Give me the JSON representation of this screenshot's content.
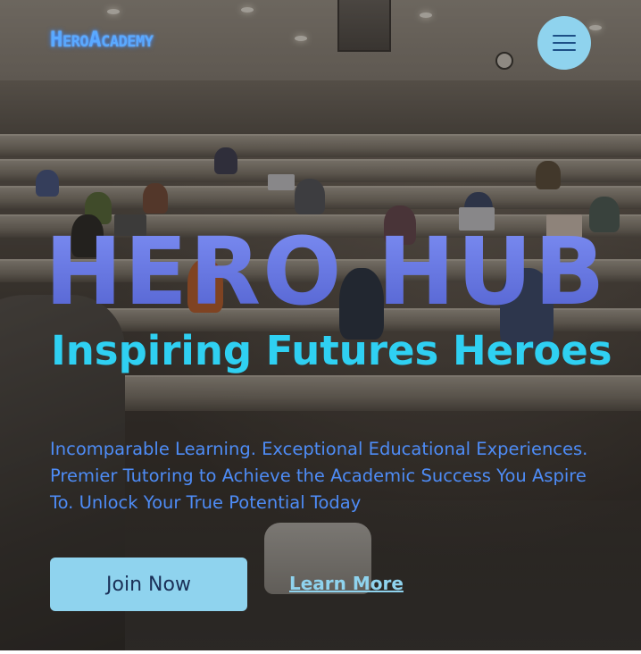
{
  "header": {
    "logo_text": "HeroAcademy",
    "menu_icon": "hamburger-menu-icon"
  },
  "hero": {
    "title": "HERO HUB",
    "subtitle": "Inspiring Futures Heroes",
    "description": "Incomparable Learning. Exceptional Educational Experiences. Premier Tutoring to Achieve the Academic Success You Aspire To. Unlock Your True Potential Today",
    "background_image": "lecture-hall-students-photo"
  },
  "actions": {
    "primary_label": "Join Now",
    "secondary_label": "Learn More"
  },
  "colors": {
    "accent_light_blue": "#8fd3ee",
    "title_blue": "#6e7fe6",
    "subtitle_cyan": "#2fd0f2",
    "description_blue": "#4e8cf6",
    "logo_blue": "#5aa9ff"
  }
}
